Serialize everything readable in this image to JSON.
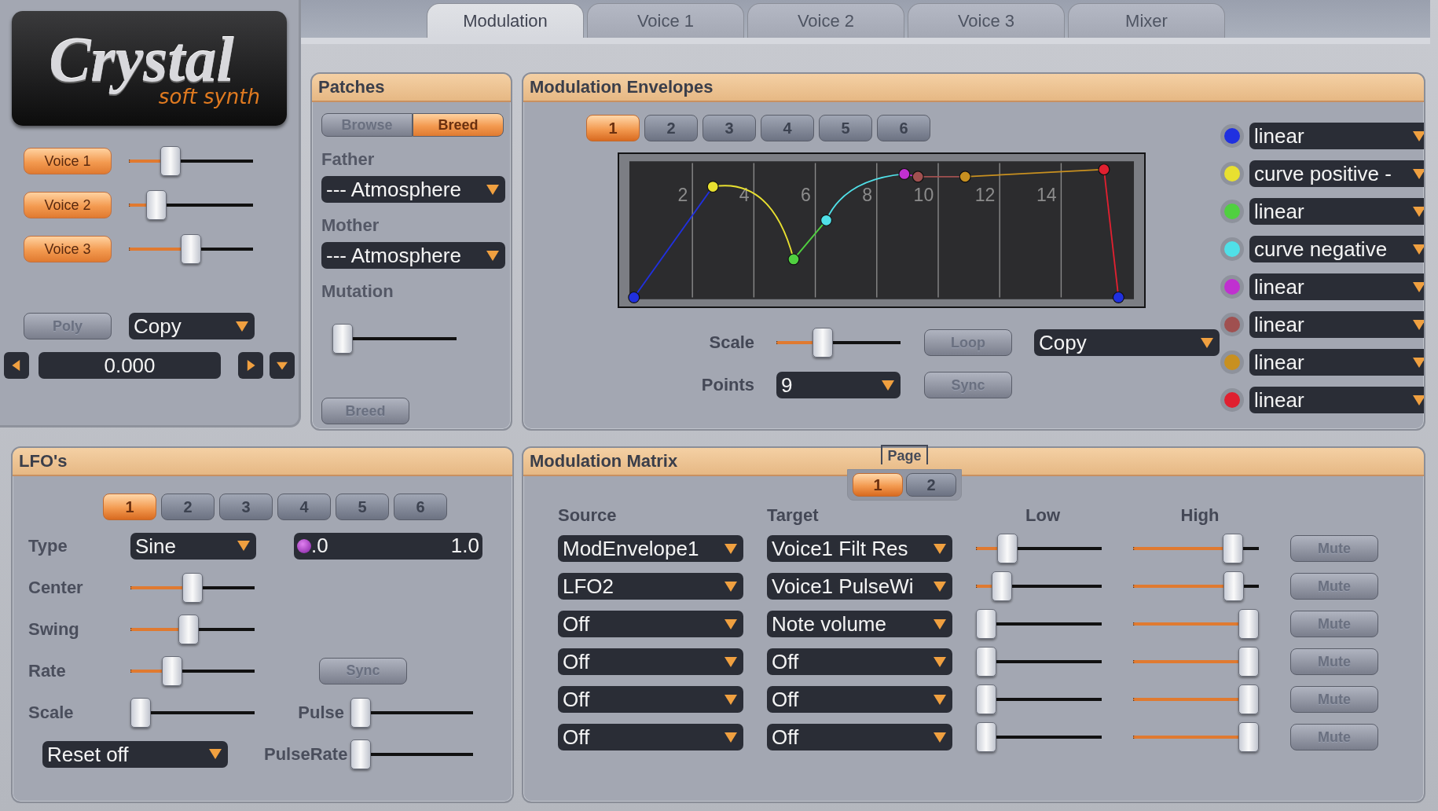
{
  "logo": {
    "title": "Crystal",
    "subtitle": "soft synth"
  },
  "voices": [
    {
      "label": "Voice 1",
      "on": true,
      "level": 0.3
    },
    {
      "label": "Voice 2",
      "on": true,
      "level": 0.17
    },
    {
      "label": "Voice 3",
      "on": true,
      "level": 0.5
    }
  ],
  "poly": {
    "label": "Poly",
    "on": false
  },
  "copy_menu": "Copy",
  "spinner": "0.000",
  "tabs": [
    {
      "label": "Modulation",
      "selected": true
    },
    {
      "label": "Voice 1",
      "selected": false
    },
    {
      "label": "Voice 2",
      "selected": false
    },
    {
      "label": "Voice 3",
      "selected": false
    },
    {
      "label": "Mixer",
      "selected": false
    }
  ],
  "patches": {
    "title": "Patches",
    "modes": [
      {
        "label": "Browse",
        "selected": false
      },
      {
        "label": "Breed",
        "selected": true
      }
    ],
    "father_label": "Father",
    "father": "--- Atmosphere",
    "mother_label": "Mother",
    "mother": "--- Atmosphere",
    "mutation_label": "Mutation",
    "mutation": {
      "level": 0
    },
    "breed": {
      "label": "Breed",
      "on": false
    }
  },
  "envelopes": {
    "title": "Modulation Envelopes",
    "numbers": [
      {
        "label": "1",
        "selected": true
      },
      {
        "label": "2",
        "selected": false
      },
      {
        "label": "3",
        "selected": false
      },
      {
        "label": "4",
        "selected": false
      },
      {
        "label": "5",
        "selected": false
      },
      {
        "label": "6",
        "selected": false
      }
    ],
    "graph": {
      "x_labels": [
        "2",
        "4",
        "6",
        "8",
        "10",
        "12",
        "14"
      ]
    },
    "scale_label": "Scale",
    "scale": {
      "level": 0.35
    },
    "points_label": "Points",
    "points": "9",
    "loop": {
      "label": "Loop",
      "on": false
    },
    "sync": {
      "label": "Sync",
      "on": false
    },
    "copy": "Copy",
    "curves": [
      {
        "color": "#2030e0",
        "type": "linear"
      },
      {
        "color": "#e8e030",
        "type": "curve positive -"
      },
      {
        "color": "#50d040",
        "type": "linear"
      },
      {
        "color": "#50e0e8",
        "type": "curve negative"
      },
      {
        "color": "#c030d0",
        "type": "linear"
      },
      {
        "color": "#a05050",
        "type": "linear"
      },
      {
        "color": "#c89020",
        "type": "linear"
      },
      {
        "color": "#e02030",
        "type": "linear"
      }
    ]
  },
  "lfos": {
    "title": "LFO's",
    "numbers": [
      {
        "label": "1",
        "selected": true
      },
      {
        "label": "2",
        "selected": false
      },
      {
        "label": "3",
        "selected": false
      },
      {
        "label": "4",
        "selected": false
      },
      {
        "label": "5",
        "selected": false
      },
      {
        "label": "6",
        "selected": false
      }
    ],
    "type_label": "Type",
    "type": "Sine",
    "range": {
      "low": ".0",
      "high": "1.0"
    },
    "sliders": [
      {
        "label": "Center",
        "level": 0.5
      },
      {
        "label": "Swing",
        "level": 0.46
      },
      {
        "label": "Rate",
        "level": 0.3
      },
      {
        "label": "Scale",
        "level": 0
      }
    ],
    "sync": {
      "label": "Sync",
      "on": false
    },
    "reset": "Reset off",
    "pulse": {
      "label": "Pulse",
      "level": 0
    },
    "pulse_rate": {
      "label": "PulseRate",
      "level": 0
    }
  },
  "matrix": {
    "title": "Modulation Matrix",
    "page_label": "Page",
    "pages": [
      {
        "label": "1",
        "selected": true
      },
      {
        "label": "2",
        "selected": false
      }
    ],
    "columns": [
      "Source",
      "Target",
      "Low",
      "High"
    ],
    "rows": [
      {
        "source": "ModEnvelope1",
        "target": "Voice1 Filt Res",
        "low": {
          "level": 0.2
        },
        "high": {
          "level": 0.85
        },
        "mute": {
          "label": "Mute",
          "on": false
        }
      },
      {
        "source": "LFO2",
        "target": "Voice1 PulseWi",
        "low": {
          "level": 0.15
        },
        "high": {
          "level": 0.86
        },
        "mute": {
          "label": "Mute",
          "on": false
        }
      },
      {
        "source": "Off",
        "target": "Note volume",
        "low": {
          "level": 0
        },
        "high": {
          "level": 1
        },
        "mute": {
          "label": "Mute",
          "on": false
        }
      },
      {
        "source": "Off",
        "target": "Off",
        "low": {
          "level": 0
        },
        "high": {
          "level": 1
        },
        "mute": {
          "label": "Mute",
          "on": false
        }
      },
      {
        "source": "Off",
        "target": "Off",
        "low": {
          "level": 0
        },
        "high": {
          "level": 1
        },
        "mute": {
          "label": "Mute",
          "on": false
        }
      },
      {
        "source": "Off",
        "target": "Off",
        "low": {
          "level": 0
        },
        "high": {
          "level": 1
        },
        "mute": {
          "label": "Mute",
          "on": false
        }
      }
    ]
  }
}
